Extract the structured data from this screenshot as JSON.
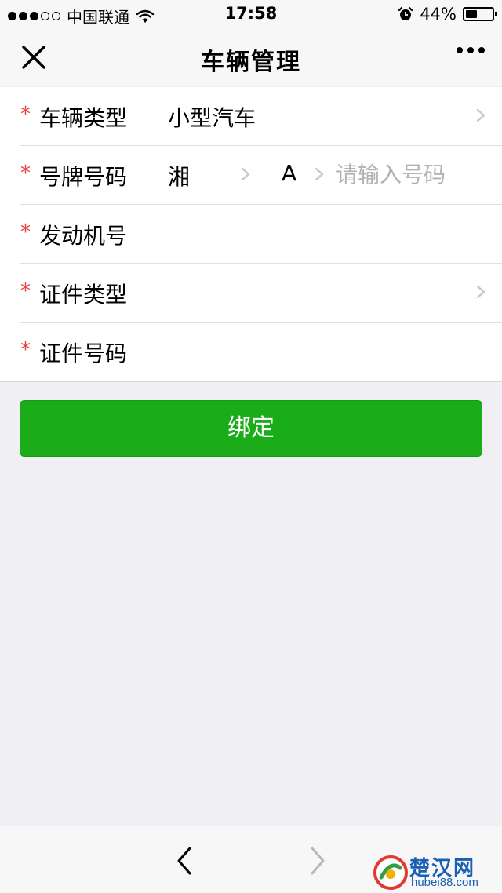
{
  "status_bar": {
    "carrier": "中国联通",
    "time": "17:58",
    "battery": "44%",
    "battery_level": 0.44,
    "signal_bars_filled": 3,
    "signal_bars_total": 5
  },
  "nav": {
    "title": "车辆管理",
    "close_icon": "close-icon",
    "more_icon": "more-icon"
  },
  "form": {
    "required_mark": "*",
    "vehicle_type": {
      "label": "车辆类型",
      "value": "小型汽车"
    },
    "plate": {
      "label": "号牌号码",
      "province": "湘",
      "letter": "A",
      "value": "",
      "placeholder": "请输入号码"
    },
    "engine": {
      "label": "发动机号"
    },
    "id_type": {
      "label": "证件类型"
    },
    "id_number": {
      "label": "证件号码"
    }
  },
  "bind_button": {
    "label": "绑定"
  },
  "toolbar": {
    "back_icon": "chevron-left-icon",
    "forward_icon": "chevron-right-icon"
  },
  "watermark": {
    "title": "楚汉网",
    "url": "hubei88.com"
  },
  "colors": {
    "accent_green": "#1aad19",
    "required_red": "#e64340",
    "background": "#efeff4"
  }
}
